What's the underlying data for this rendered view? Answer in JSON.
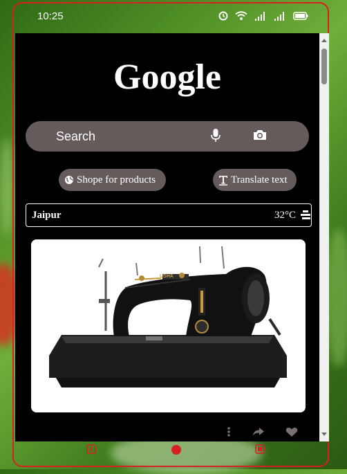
{
  "status_bar": {
    "time": "10:25",
    "icons": [
      "alarm-icon",
      "wifi-icon",
      "signal-icon",
      "signal-icon",
      "battery-icon"
    ]
  },
  "app": {
    "logo": "Google",
    "search": {
      "placeholder": "Search",
      "icons": [
        "mic-icon",
        "camera-icon"
      ]
    },
    "chips": [
      {
        "label": "Shope for products",
        "icon": "globe-icon"
      },
      {
        "label": "Translate text",
        "icon": "text-icon"
      }
    ],
    "weather": {
      "city": "Jaipur",
      "temperature": "32°C",
      "icon": "fog-icon"
    },
    "product_card": {
      "image": "sewing-machine-image",
      "brand_text": "USHA",
      "actions": [
        "more-icon",
        "share-icon",
        "heart-icon"
      ]
    }
  },
  "navigation": {
    "buttons": [
      "back-button",
      "home-button",
      "recents-button"
    ]
  },
  "colors": {
    "frame": "#d92020",
    "screen_bg": "#000000",
    "surface": "#645b5a",
    "text": "#ffffff",
    "action_icon": "#7a6f6f"
  }
}
